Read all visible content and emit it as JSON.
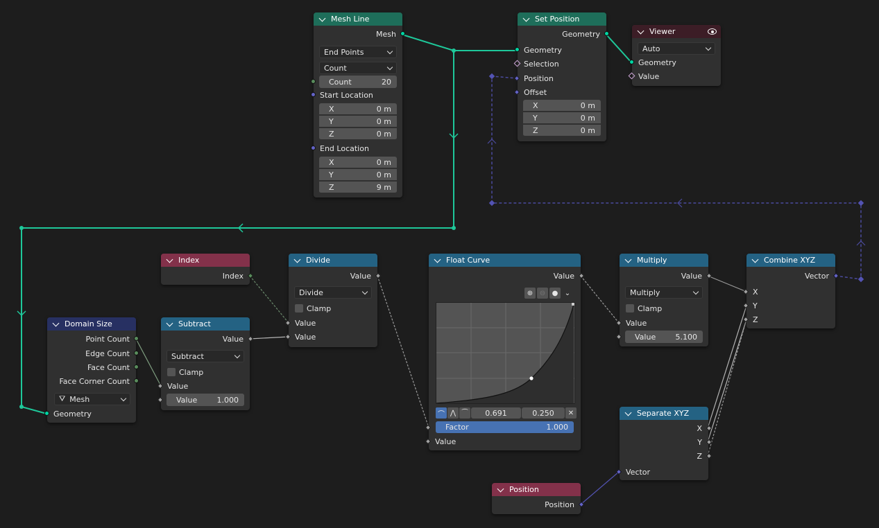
{
  "colors": {
    "geometry_wire": "#1ec89a",
    "vector_wire": "#5353b3",
    "float_wire": "#9a9a9a",
    "geometry_header": "#1e6e5a",
    "input_header": "#83314a",
    "converter_header": "#246283"
  },
  "mesh_line": {
    "title": "Mesh Line",
    "out_mesh": "Mesh",
    "mode": "End Points",
    "count_mode": "Count",
    "count_label": "Count",
    "count_value": "20",
    "start_label": "Start Location",
    "start": [
      {
        "axis": "X",
        "val": "0 m"
      },
      {
        "axis": "Y",
        "val": "0 m"
      },
      {
        "axis": "Z",
        "val": "0 m"
      }
    ],
    "end_label": "End Location",
    "end": [
      {
        "axis": "X",
        "val": "0 m"
      },
      {
        "axis": "Y",
        "val": "0 m"
      },
      {
        "axis": "Z",
        "val": "9 m"
      }
    ]
  },
  "set_position": {
    "title": "Set Position",
    "out_geometry": "Geometry",
    "in_geometry": "Geometry",
    "selection": "Selection",
    "position": "Position",
    "offset": "Offset",
    "offset_vals": [
      {
        "axis": "X",
        "val": "0 m"
      },
      {
        "axis": "Y",
        "val": "0 m"
      },
      {
        "axis": "Z",
        "val": "0 m"
      }
    ]
  },
  "viewer": {
    "title": "Viewer",
    "domain": "Auto",
    "geometry": "Geometry",
    "value": "Value",
    "eye_icon": "eye-icon"
  },
  "index": {
    "title": "Index",
    "out": "Index"
  },
  "divide": {
    "title": "Divide",
    "out": "Value",
    "op": "Divide",
    "clamp": "Clamp",
    "in1": "Value",
    "in2": "Value"
  },
  "float_curve": {
    "title": "Float Curve",
    "out": "Value",
    "point_x": "0.691",
    "point_y": "0.250",
    "factor_label": "Factor",
    "factor_value": "1.000",
    "in": "Value"
  },
  "multiply": {
    "title": "Multiply",
    "out": "Value",
    "op": "Multiply",
    "clamp": "Clamp",
    "in1": "Value",
    "in2_label": "Value",
    "in2_value": "5.100"
  },
  "combine": {
    "title": "Combine XYZ",
    "out": "Vector",
    "x": "X",
    "y": "Y",
    "z": "Z"
  },
  "domain_size": {
    "title": "Domain Size",
    "point": "Point Count",
    "edge": "Edge Count",
    "face": "Face Count",
    "corner": "Face Corner Count",
    "component": "Mesh",
    "geometry": "Geometry"
  },
  "subtract": {
    "title": "Subtract",
    "out": "Value",
    "op": "Subtract",
    "clamp": "Clamp",
    "in1": "Value",
    "in2_label": "Value",
    "in2_value": "1.000"
  },
  "separate": {
    "title": "Separate XYZ",
    "x": "X",
    "y": "Y",
    "z": "Z",
    "vector": "Vector"
  },
  "position": {
    "title": "Position",
    "out": "Position"
  }
}
